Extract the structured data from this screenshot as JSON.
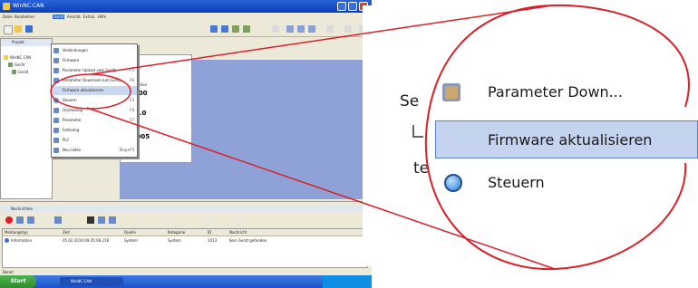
{
  "app": {
    "title": "WinNC.CAN"
  },
  "menubar": {
    "items": [
      "Datei",
      "Bearbeiten",
      "Gerät",
      "Ansicht",
      "Extras",
      "Hilfe"
    ]
  },
  "left_pane": {
    "tab": "Projekt",
    "tree": [
      "WinNC.CAN",
      "Gerät",
      "Gerät"
    ]
  },
  "properties": {
    "rows": [
      "Funktion",
      "0000",
      "0.0",
      "0.005"
    ]
  },
  "menu": {
    "items": [
      {
        "label": "Verbindungen",
        "shortcut": ""
      },
      {
        "label": "Firmware",
        "shortcut": ""
      },
      {
        "label": "Parameter Upload vom Gerät",
        "shortcut": "F5"
      },
      {
        "label": "Parameter Download zum Gerät",
        "shortcut": "F6"
      },
      {
        "label": "Firmware aktualisieren",
        "shortcut": ""
      },
      {
        "label": "Steuern",
        "shortcut": "F3"
      },
      {
        "label": "Oszilloskop",
        "shortcut": "F4"
      },
      {
        "label": "Parameter",
        "shortcut": "F7"
      },
      {
        "label": "Fehlerlog",
        "shortcut": ""
      },
      {
        "label": "PLC",
        "shortcut": ""
      },
      {
        "label": "Neu laden",
        "shortcut": "Strg+F5"
      }
    ],
    "highlighted_index": 4
  },
  "bottom": {
    "title": "Nachrichten",
    "columns": [
      "Meldungstyp",
      "Zeit",
      "Quelle",
      "Kategorie",
      "ID",
      "Nachricht"
    ],
    "rows": [
      [
        "Information",
        "05.02.2014 09:35:08.218",
        "System",
        "System",
        "1013",
        "Kein Gerät gefunden"
      ]
    ]
  },
  "statusbar": {
    "text": "Bereit"
  },
  "taskbar": {
    "start": "Start",
    "window": "WinNC.CAN"
  },
  "zoom": {
    "items": [
      {
        "label": "Parameter Down...",
        "icon": "parameter-download-icon"
      },
      {
        "label": "Firmware aktualisieren",
        "icon": ""
      },
      {
        "label": "Steuern",
        "icon": "steuern-icon"
      }
    ],
    "left_fragments": [
      "Se",
      "te"
    ]
  },
  "colors": {
    "annotation": "#d9202a",
    "highlight": "#c5d4ee",
    "highlight_border": "#5b7bc4"
  }
}
